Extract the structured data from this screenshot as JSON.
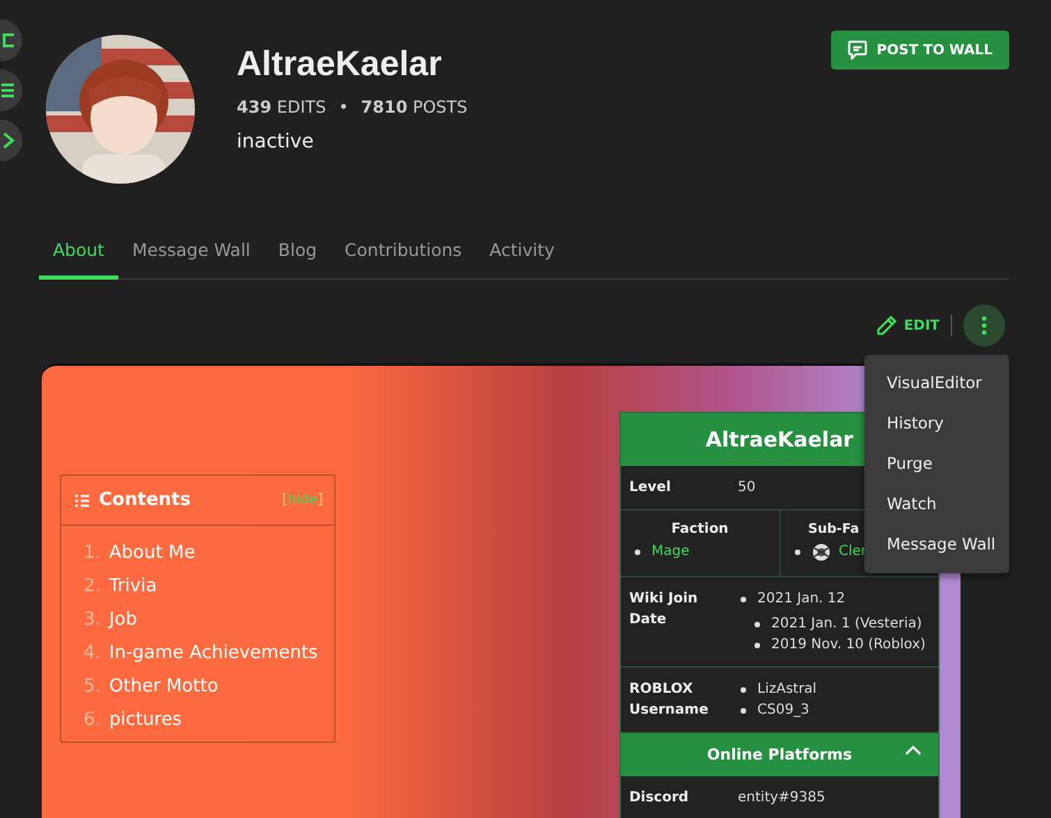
{
  "profile": {
    "username": "AltraeKaelar",
    "stats": [
      {
        "count": "439",
        "label": "EDITS"
      },
      {
        "separator": "•",
        "count": "7810",
        "label": "POSTS"
      }
    ],
    "status": "inactive"
  },
  "post_button": "POST TO WALL",
  "tabs": [
    {
      "label": "About",
      "selected": true
    },
    {
      "label": "Message Wall",
      "selected": false
    },
    {
      "label": "Blog",
      "selected": false
    },
    {
      "label": "Contributions",
      "selected": false
    },
    {
      "label": "Activity",
      "selected": false
    }
  ],
  "edit_button": "EDIT",
  "more_menu": {
    "open": true,
    "items": [
      "VisualEditor",
      "History",
      "Purge",
      "Watch",
      "Message Wall"
    ]
  },
  "contents": {
    "title": "Contents",
    "toggle": {
      "open": "[",
      "label": "hide",
      "close": "]"
    },
    "items": [
      {
        "number": "1.",
        "label": "About Me"
      },
      {
        "number": "2.",
        "label": "Trivia"
      },
      {
        "number": "3.",
        "label": "Job"
      },
      {
        "number": "4.",
        "label": "In-game Achievements"
      },
      {
        "number": "5.",
        "label": "Other Motto"
      },
      {
        "number": "6.",
        "label": "pictures"
      }
    ]
  },
  "infobox": {
    "title": "AltraeKaelar",
    "rows": [
      {
        "kind": "pair",
        "label": "Level",
        "value": "50"
      },
      {
        "kind": "columns",
        "columns": [
          {
            "heading": "Faction",
            "items": [
              {
                "text": "Mage",
                "icon": false
              }
            ]
          },
          {
            "heading": "Sub-Fa",
            "items": [
              {
                "text": "Cler",
                "icon": true
              }
            ]
          }
        ]
      },
      {
        "kind": "list",
        "label": "Wiki Join Date",
        "items": [
          {
            "text": "2021 Jan. 12",
            "children": [
              {
                "text": "2021 Jan. 1 (Vesteria)"
              },
              {
                "text": "2019 Nov. 10 (Roblox)"
              }
            ]
          }
        ]
      },
      {
        "kind": "list",
        "label": "ROBLOX Username",
        "items": [
          {
            "text": "LizAstral"
          },
          {
            "text": "CS09_3"
          }
        ]
      },
      {
        "kind": "section",
        "label": "Online Platforms",
        "expanded": true
      },
      {
        "kind": "pair",
        "label": "Discord",
        "value": "entity#9385"
      }
    ]
  }
}
